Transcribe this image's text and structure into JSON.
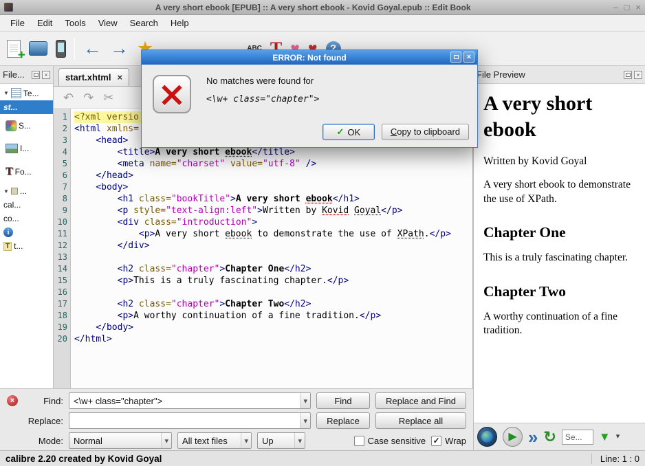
{
  "window": {
    "title": "A very short ebook [EPUB] :: A very short ebook - Kovid Goyal.epub :: Edit Book",
    "controls": [
      "–",
      "□",
      "×"
    ]
  },
  "menubar": {
    "items": [
      "File",
      "Edit",
      "Tools",
      "View",
      "Search",
      "Help"
    ]
  },
  "toolbar": {
    "icons": [
      {
        "name": "new-file-icon",
        "kind": "ic-newdoc"
      },
      {
        "name": "open-book-icon",
        "kind": "ic-bluebook"
      },
      {
        "name": "send-to-device-icon",
        "kind": "ic-phone"
      },
      {
        "name": "toolbar-separator",
        "kind": "sep"
      },
      {
        "name": "back-icon",
        "kind": "ic-glyph blue-arrow",
        "glyph": "←"
      },
      {
        "name": "forward-icon",
        "kind": "ic-glyph blue-arrow",
        "glyph": "→"
      },
      {
        "name": "donate-star-icon",
        "kind": "ic-glyph star",
        "glyph": "★"
      },
      {
        "name": "toolbar-gap",
        "kind": "gap",
        "width": 112
      },
      {
        "name": "spellcheck-icon",
        "kind": "ic-abc",
        "glyph": "ABC"
      },
      {
        "name": "manage-fonts-icon",
        "kind": "ic-glyph redT",
        "glyph": "T"
      },
      {
        "name": "heart-icon",
        "kind": "ic-glyph heart-pink",
        "glyph": "♥"
      },
      {
        "name": "heart2-icon",
        "kind": "ic-glyph heart-red",
        "glyph": "♥"
      },
      {
        "name": "help-icon",
        "kind": "ic-help",
        "glyph": "?"
      }
    ]
  },
  "file_browser": {
    "header": "File...",
    "items": [
      {
        "label": "Te...",
        "icon": "text-category-icon",
        "icon_kind": "fi-text",
        "expanded": true
      },
      {
        "label": "st...",
        "selected": true
      },
      {
        "label": "S...",
        "icon": "styles-category-icon",
        "icon_kind": "fi-styles",
        "size": "big"
      },
      {
        "label": "I...",
        "icon": "images-category-icon",
        "icon_kind": "fi-images",
        "size": "big"
      },
      {
        "label": "Fo...",
        "icon": "fonts-category-icon",
        "icon_kind": "fi-fonts",
        "icon_glyph": "T",
        "size": "big"
      },
      {
        "label": "...",
        "icon": "misc-category-icon",
        "icon_kind": "fi-misc",
        "expanded": true
      },
      {
        "label": "cal..."
      },
      {
        "label": "co..."
      },
      {
        "label": "",
        "icon": "info-icon",
        "icon_kind": "fi-info",
        "icon_glyph": "i"
      },
      {
        "label": "t...",
        "icon": "toc-file-icon",
        "icon_kind": "fi-toc",
        "icon_glyph": "T"
      }
    ]
  },
  "editor": {
    "tab": "start.xhtml",
    "toolbar_icons": [
      {
        "name": "undo-icon",
        "glyph": "↶"
      },
      {
        "name": "redo-icon",
        "glyph": "↷"
      },
      {
        "name": "cut-icon",
        "glyph": "✂"
      }
    ],
    "current_line": 1,
    "lines": [
      [
        [
          "attr",
          "<?xml versio"
        ]
      ],
      [
        [
          "tag",
          "<html"
        ],
        [
          "attr",
          " xmlns="
        ]
      ],
      [
        [
          "txt",
          "    "
        ],
        [
          "tag",
          "<head>"
        ]
      ],
      [
        [
          "txt",
          "        "
        ],
        [
          "tag",
          "<title>"
        ],
        [
          "btxt",
          "A very short "
        ],
        [
          "btxt msp",
          "ebook"
        ],
        [
          "tag",
          "</title>"
        ]
      ],
      [
        [
          "txt",
          "        "
        ],
        [
          "tag",
          "<meta"
        ],
        [
          "attr",
          " name="
        ],
        [
          "val",
          "\"charset\""
        ],
        [
          "attr",
          " value="
        ],
        [
          "val",
          "\"utf-8\""
        ],
        [
          "tag",
          " />"
        ]
      ],
      [
        [
          "txt",
          "    "
        ],
        [
          "tag",
          "</head>"
        ]
      ],
      [
        [
          "txt",
          "    "
        ],
        [
          "tag",
          "<body>"
        ]
      ],
      [
        [
          "txt",
          "        "
        ],
        [
          "tag",
          "<h1"
        ],
        [
          "attr",
          " class="
        ],
        [
          "val",
          "\"bookTitle\""
        ],
        [
          "tag",
          ">"
        ],
        [
          "btxt",
          "A very short "
        ],
        [
          "btxt msp",
          "ebook"
        ],
        [
          "tag",
          "</h1>"
        ]
      ],
      [
        [
          "txt",
          "        "
        ],
        [
          "tag",
          "<p"
        ],
        [
          "attr",
          " style="
        ],
        [
          "val",
          "\"text-align:left\""
        ],
        [
          "tag",
          ">"
        ],
        [
          "txt",
          "Written by "
        ],
        [
          "txt msp",
          "Kovid"
        ],
        [
          "txt",
          " "
        ],
        [
          "txt msp",
          "Goyal"
        ],
        [
          "tag",
          "</p>"
        ]
      ],
      [
        [
          "txt",
          "        "
        ],
        [
          "tag",
          "<div"
        ],
        [
          "attr",
          " class="
        ],
        [
          "val",
          "\"introduction\""
        ],
        [
          "tag",
          ">"
        ]
      ],
      [
        [
          "txt",
          "            "
        ],
        [
          "tag",
          "<p>"
        ],
        [
          "txt",
          "A very short "
        ],
        [
          "txt msp",
          "ebook"
        ],
        [
          "txt",
          " to demonstrate the use of "
        ],
        [
          "txt msp",
          "XPath"
        ],
        [
          "txt",
          "."
        ],
        [
          "tag",
          "</p>"
        ]
      ],
      [
        [
          "txt",
          "        "
        ],
        [
          "tag",
          "</div>"
        ]
      ],
      [],
      [
        [
          "txt",
          "        "
        ],
        [
          "tag",
          "<h2"
        ],
        [
          "attr",
          " class="
        ],
        [
          "val",
          "\"chapter\""
        ],
        [
          "tag",
          ">"
        ],
        [
          "btxt",
          "Chapter One"
        ],
        [
          "tag",
          "</h2>"
        ]
      ],
      [
        [
          "txt",
          "        "
        ],
        [
          "tag",
          "<p>"
        ],
        [
          "txt",
          "This is a truly fascinating chapter."
        ],
        [
          "tag",
          "</p>"
        ]
      ],
      [],
      [
        [
          "txt",
          "        "
        ],
        [
          "tag",
          "<h2"
        ],
        [
          "attr",
          " class="
        ],
        [
          "val",
          "\"chapter\""
        ],
        [
          "tag",
          ">"
        ],
        [
          "btxt",
          "Chapter Two"
        ],
        [
          "tag",
          "</h2>"
        ]
      ],
      [
        [
          "txt",
          "        "
        ],
        [
          "tag",
          "<p>"
        ],
        [
          "txt",
          "A worthy continuation of a fine tradition."
        ],
        [
          "tag",
          "</p>"
        ]
      ],
      [
        [
          "txt",
          "    "
        ],
        [
          "tag",
          "</body>"
        ]
      ],
      [
        [
          "tag",
          "</html>"
        ]
      ]
    ]
  },
  "preview": {
    "header": "File Preview",
    "search_value": "Se...",
    "blocks": [
      {
        "type": "h1",
        "text": "A very short ebook"
      },
      {
        "type": "p",
        "text": "Written by Kovid Goyal"
      },
      {
        "type": "p",
        "text": "A very short ebook to demonstrate the use of XPath."
      },
      {
        "type": "h2",
        "text": "Chapter One"
      },
      {
        "type": "p",
        "text": "This is a truly fascinating chapter."
      },
      {
        "type": "h2",
        "text": "Chapter Two"
      },
      {
        "type": "p",
        "text": "A worthy continuation of a fine tradition."
      }
    ]
  },
  "dialog": {
    "title": "ERROR: Not found",
    "message": "No matches were found for",
    "pattern": "<\\w+ class=\"chapter\">",
    "ok_label": "OK",
    "copy_label": "Copy to clipboard"
  },
  "search_panel": {
    "find_label": "Find:",
    "find_value": "<\\w+ class=\"chapter\">",
    "find_button": "Find",
    "replace_and_find_button": "Replace and Find",
    "replace_label": "Replace:",
    "replace_value": "",
    "replace_button": "Replace",
    "replace_all_button": "Replace all",
    "mode_label": "Mode:",
    "mode_value": "Normal",
    "files_value": "All text files",
    "direction_value": "Up",
    "case_sensitive_label": "Case sensitive",
    "case_sensitive_checked": false,
    "wrap_label": "Wrap",
    "wrap_checked": true
  },
  "statusbar": {
    "left": "calibre 2.20 created by Kovid Goyal",
    "right": "Line: 1 : 0"
  }
}
